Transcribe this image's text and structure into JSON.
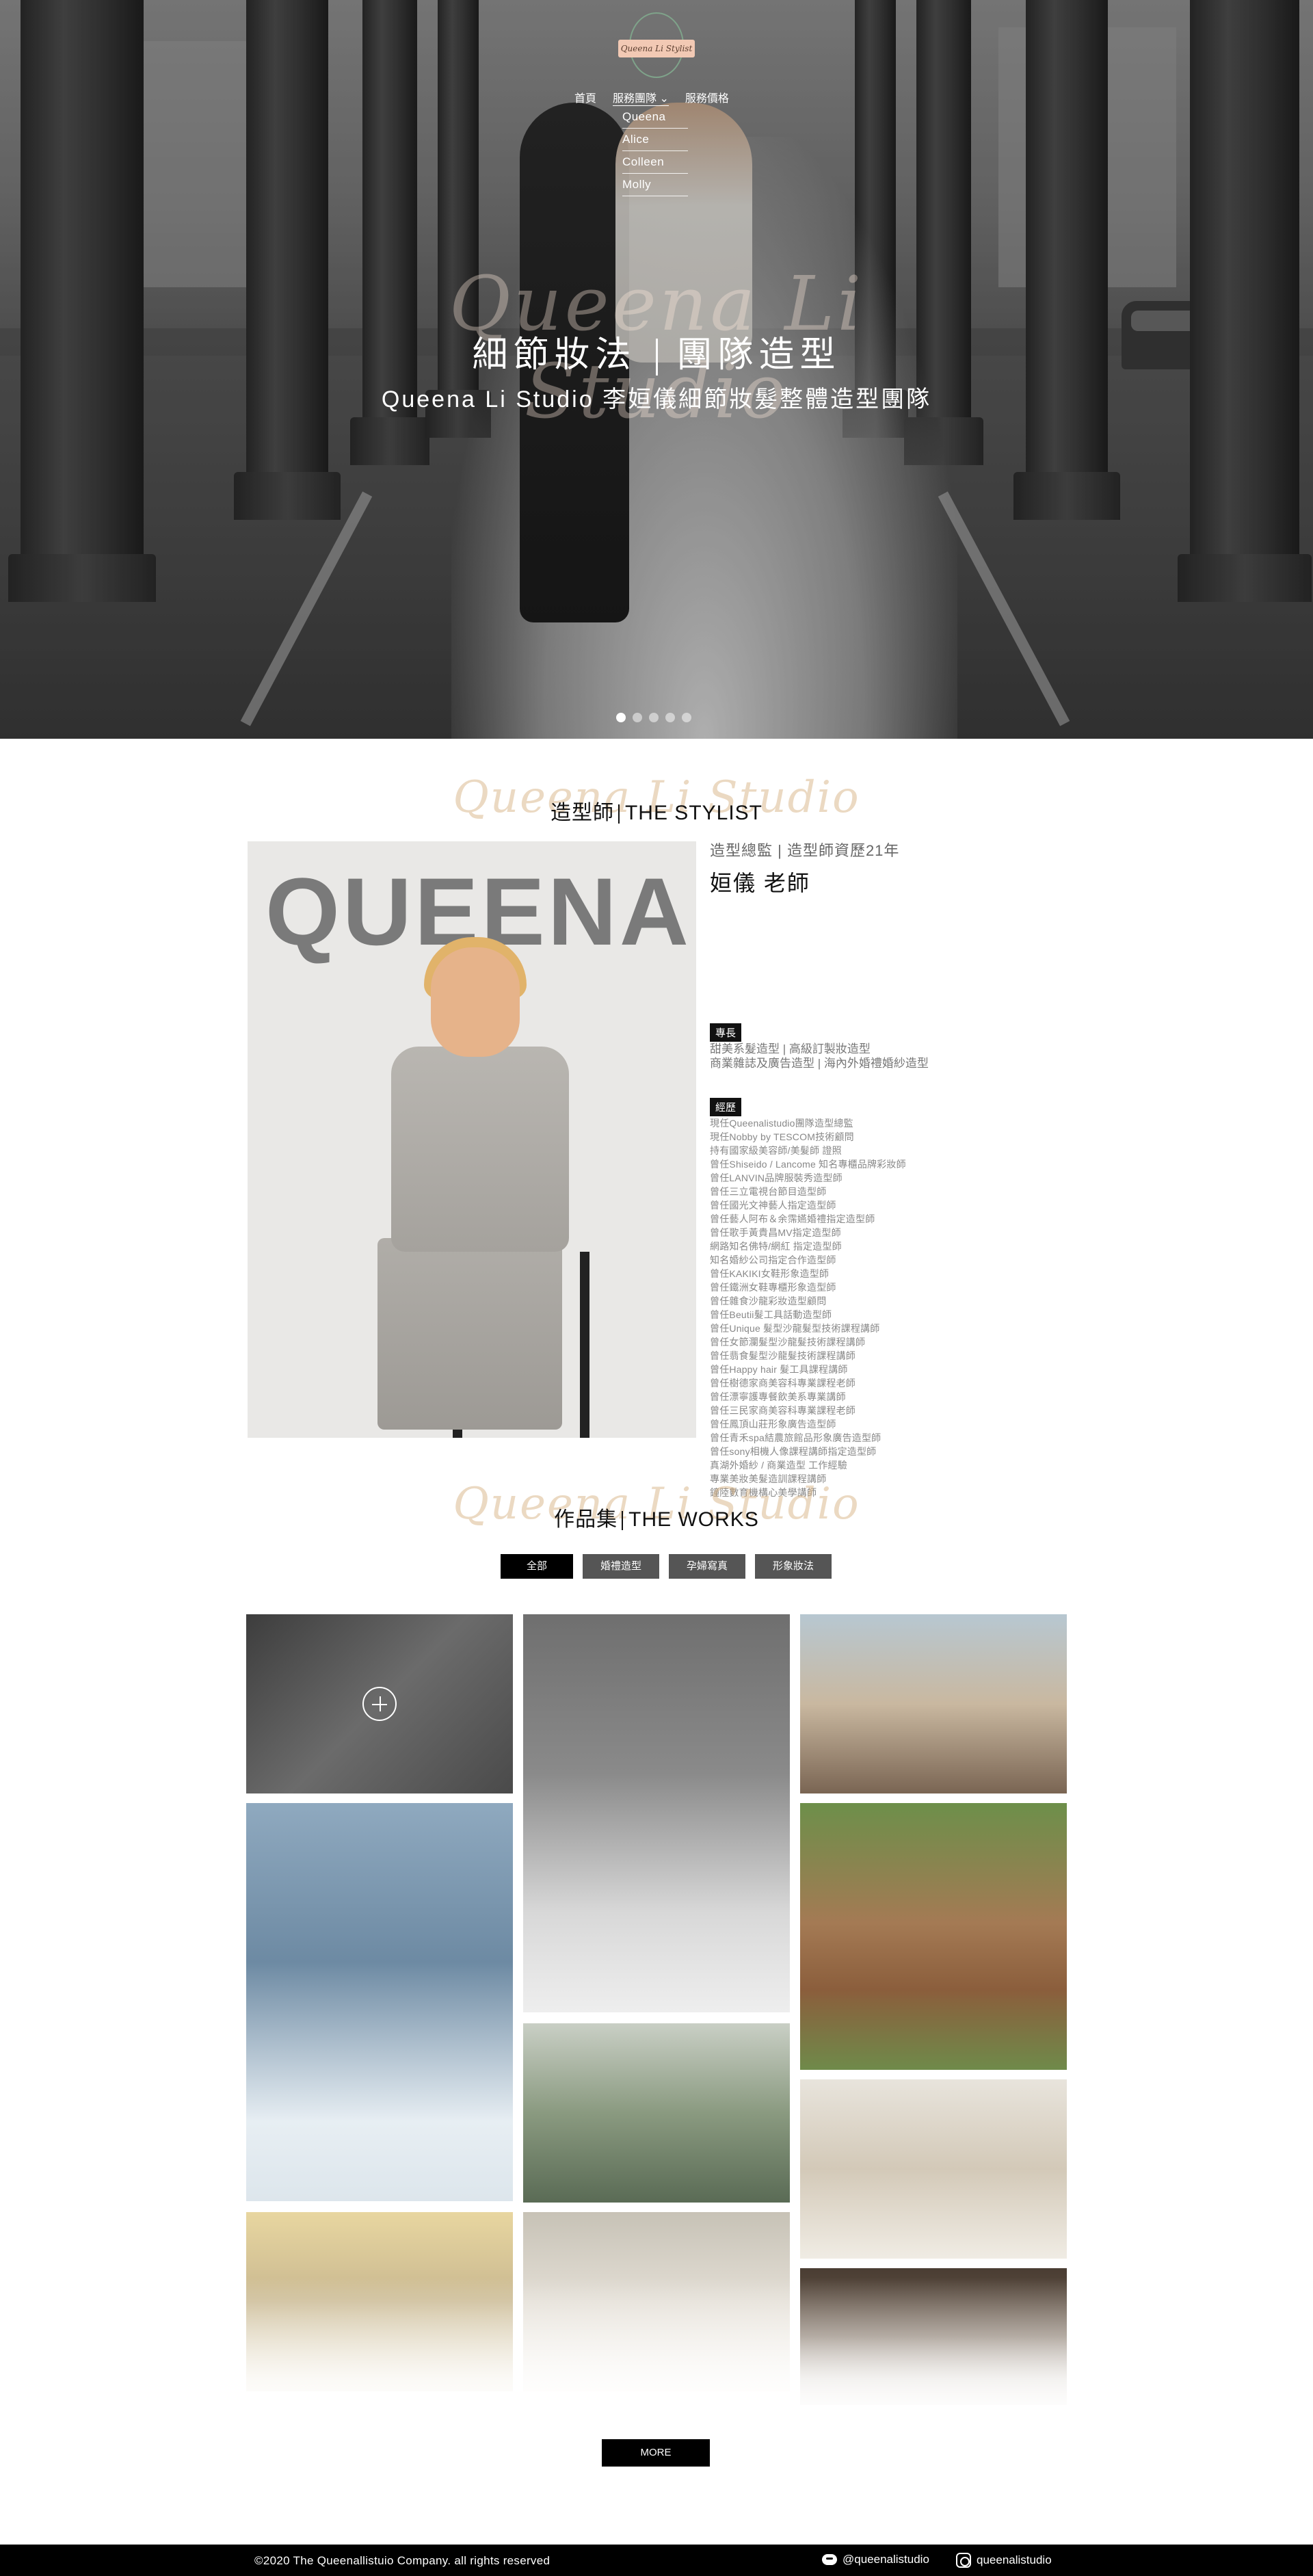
{
  "hero": {
    "logo_text": "Queena Li Stylist",
    "nav": [
      "首頁",
      "服務團隊",
      "服務價格"
    ],
    "dropdown": [
      "Queena",
      "Alice",
      "Colleen",
      "Molly"
    ],
    "watermark": "Queena Li Studio",
    "title_left": "細節妝法",
    "title_right": "團隊造型",
    "subtitle": "Queena Li Studio 李姮儀細節妝髮整體造型團隊",
    "slides_total": 5,
    "slide_active": 1
  },
  "stylist": {
    "heading_script": "Queena Li Studio",
    "heading_cn": "造型師",
    "heading_en": "THE STYLIST",
    "photo_name": "QUEENA",
    "role": "造型總監 | 造型師資歷21年",
    "name": "姮儀 老師",
    "spec_tag": "專長",
    "spec": [
      "甜美系髮造型 | 高級訂製妝造型",
      "商業雜誌及廣告造型 | 海內外婚禮婚紗造型"
    ],
    "exp_tag": "經歷",
    "experience": [
      "現任Queenalistudio團隊造型總監",
      "現任Nobby by TESCOM技術顧問",
      "持有國家級美容師/美髮師 證照",
      "曾任Shiseido / Lancome 知名專櫃品牌彩妝師",
      "曾任LANVIN品牌服裝秀造型師",
      "曾任三立電視台節目造型師",
      "曾任國光文神藝人指定造型師",
      "曾任藝人阿布＆余霈嬿婚禮指定造型師",
      "曾任歌手黃貴昌MV指定造型師",
      "網路知名佛特/網紅 指定造型師",
      "知名婚紗公司指定合作造型師",
      "曾任KAKIKI女鞋形象造型師",
      "曾任鐵洲女鞋專櫃形象造型師",
      "曾任雜食沙龍彩妝造型顧問",
      "曾任Beutii髮工具話動造型師",
      "曾任Unique 髮型沙龍髮型技術課程講師",
      "曾任女節瀾髮型沙龍髮技術課程講師",
      "曾任翡食髮型沙龍髮技術課程講師",
      "曾任Happy hair 髮工具課程講師",
      "曾任樹德家商美容科專業課程老師",
      "曾任漂寧護專餐飲美系專業講師",
      "曾任三民家商美容科專業課程老師",
      "曾任鳳頂山莊形象廣告造型師",
      "曾任青禾spa結農旅館品形象廣告造型師",
      "曾任sony相機人像課程講師指定造型師",
      "真湖外婚紗 / 商業造型 工作經驗",
      "專業美妝美髮造訓課程講師",
      "鐘陸數育機構心美學講師"
    ]
  },
  "works": {
    "heading_script": "Queena Li Studio",
    "heading_cn": "作品集",
    "heading_en": "THE WORKS",
    "filters": [
      "全部",
      "婚禮造型",
      "孕婦寫真",
      "形象妝法"
    ],
    "active_filter": 0,
    "more_label": "MORE",
    "gallery": [
      {
        "name": "gallery-wedding-couple",
        "subject": "wedding couple"
      },
      {
        "name": "gallery-maternity-gown",
        "subject": "maternity gown"
      },
      {
        "name": "gallery-couple-alley",
        "subject": "couple in alley"
      },
      {
        "name": "gallery-bride-pier",
        "subject": "bride on pier"
      },
      {
        "name": "gallery-portrait-garden",
        "subject": "portrait in garden"
      },
      {
        "name": "gallery-bride-lake",
        "subject": "bride by lake"
      },
      {
        "name": "gallery-bride-window",
        "subject": "bride by window"
      },
      {
        "name": "gallery-sunset-portrait",
        "subject": "sunset portrait"
      },
      {
        "name": "gallery-chandelier",
        "subject": "chandelier room"
      },
      {
        "name": "gallery-library-bride",
        "subject": "bride in library"
      }
    ]
  },
  "footer": {
    "copyright": "©2020 The Queenallistuio Company. all rights reserved",
    "chat_handle": "@queenalistudio",
    "ig_handle": "queenalistudio"
  },
  "colors": {
    "accent_black": "#000000",
    "filter_inactive": "#555555",
    "script_gold": "#d2aa78",
    "logo_green": "#7fa38a",
    "logo_peach": "#f2c9b4"
  }
}
